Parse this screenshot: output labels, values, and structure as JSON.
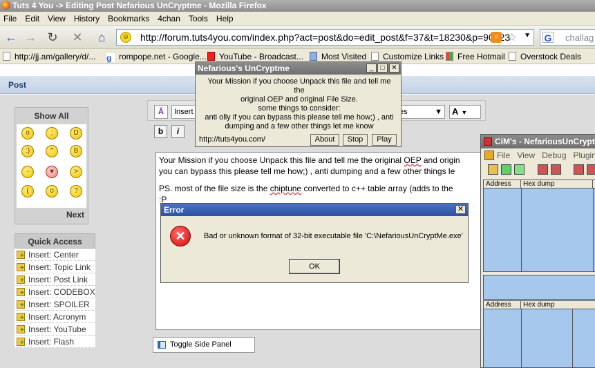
{
  "browser": {
    "title": "Tuts 4 You -> Editing Post Nefarious UnCryptme - Mozilla Firefox",
    "menu": [
      "File",
      "Edit",
      "View",
      "History",
      "Bookmarks",
      "4chan",
      "Tools",
      "Help"
    ],
    "url": "http://forum.tuts4you.com/index.php?act=post&do=edit_post&f=37&t=18230&p=90323",
    "search_text": "challag",
    "bookmarks": [
      "http://jj.am/gallery/d/...",
      "rompope.net - Google...",
      "YouTube - Broadcast...",
      "Most Visited",
      "Customize Links",
      "Free Hotmail",
      "Overstock Deals"
    ]
  },
  "forum": {
    "section_title": "Post",
    "show_all": "Show All",
    "next": "Next",
    "quick_access": "Quick Access",
    "quick_items": [
      "Insert: Center",
      "Insert: Topic Link",
      "Insert: Post Link",
      "Insert: CODEBOX",
      "Insert: SPOILER",
      "Insert: Acronym",
      "Insert: YouTube",
      "Insert: Flash"
    ],
    "toolbar": {
      "insert": "Insert",
      "size_tail": "es",
      "font_a": "A"
    },
    "format": {
      "bold": "b",
      "italic": "i"
    },
    "editor": {
      "line1": "Your Mission if you choose Unpack this file and tell me the original ",
      "oep": "OEP",
      "line1b": " and origin",
      "line2": "you can bypass this please tell me how;) , anti dumping and a few other things le",
      "line3a": "PS. most of the file size is the ",
      "chiptune": "chiptune",
      "line3b": " converted to c++ table array (adds to the",
      "line4": ":P"
    },
    "toggle_panel": "Toggle Side Panel"
  },
  "nefarious": {
    "title": "Nefarious's UnCryptme",
    "message": [
      "Your Mission if you choose Unpack this file and tell me the",
      "original OEP and original File Size.",
      "some things to consider:",
      "anti olly if you can bypass this please tell me how;) , anti",
      "dumping and a few other things let me know"
    ],
    "url": "http://tuts4you.com/",
    "buttons": {
      "about": "About",
      "stop": "Stop",
      "play": "Play"
    }
  },
  "error": {
    "title": "Error",
    "message": "Bad or unknown format of 32-bit executable file 'C:\\NefariousUnCryptMe.exe'",
    "ok": "OK"
  },
  "olly": {
    "title": "CiM's - NefariousUnCryptM",
    "menu": [
      "File",
      "View",
      "Debug",
      "Plugins"
    ],
    "top_cols": [
      "Address",
      "Hex dump"
    ],
    "bottom_cols": [
      "Address",
      "Hex dump"
    ]
  }
}
